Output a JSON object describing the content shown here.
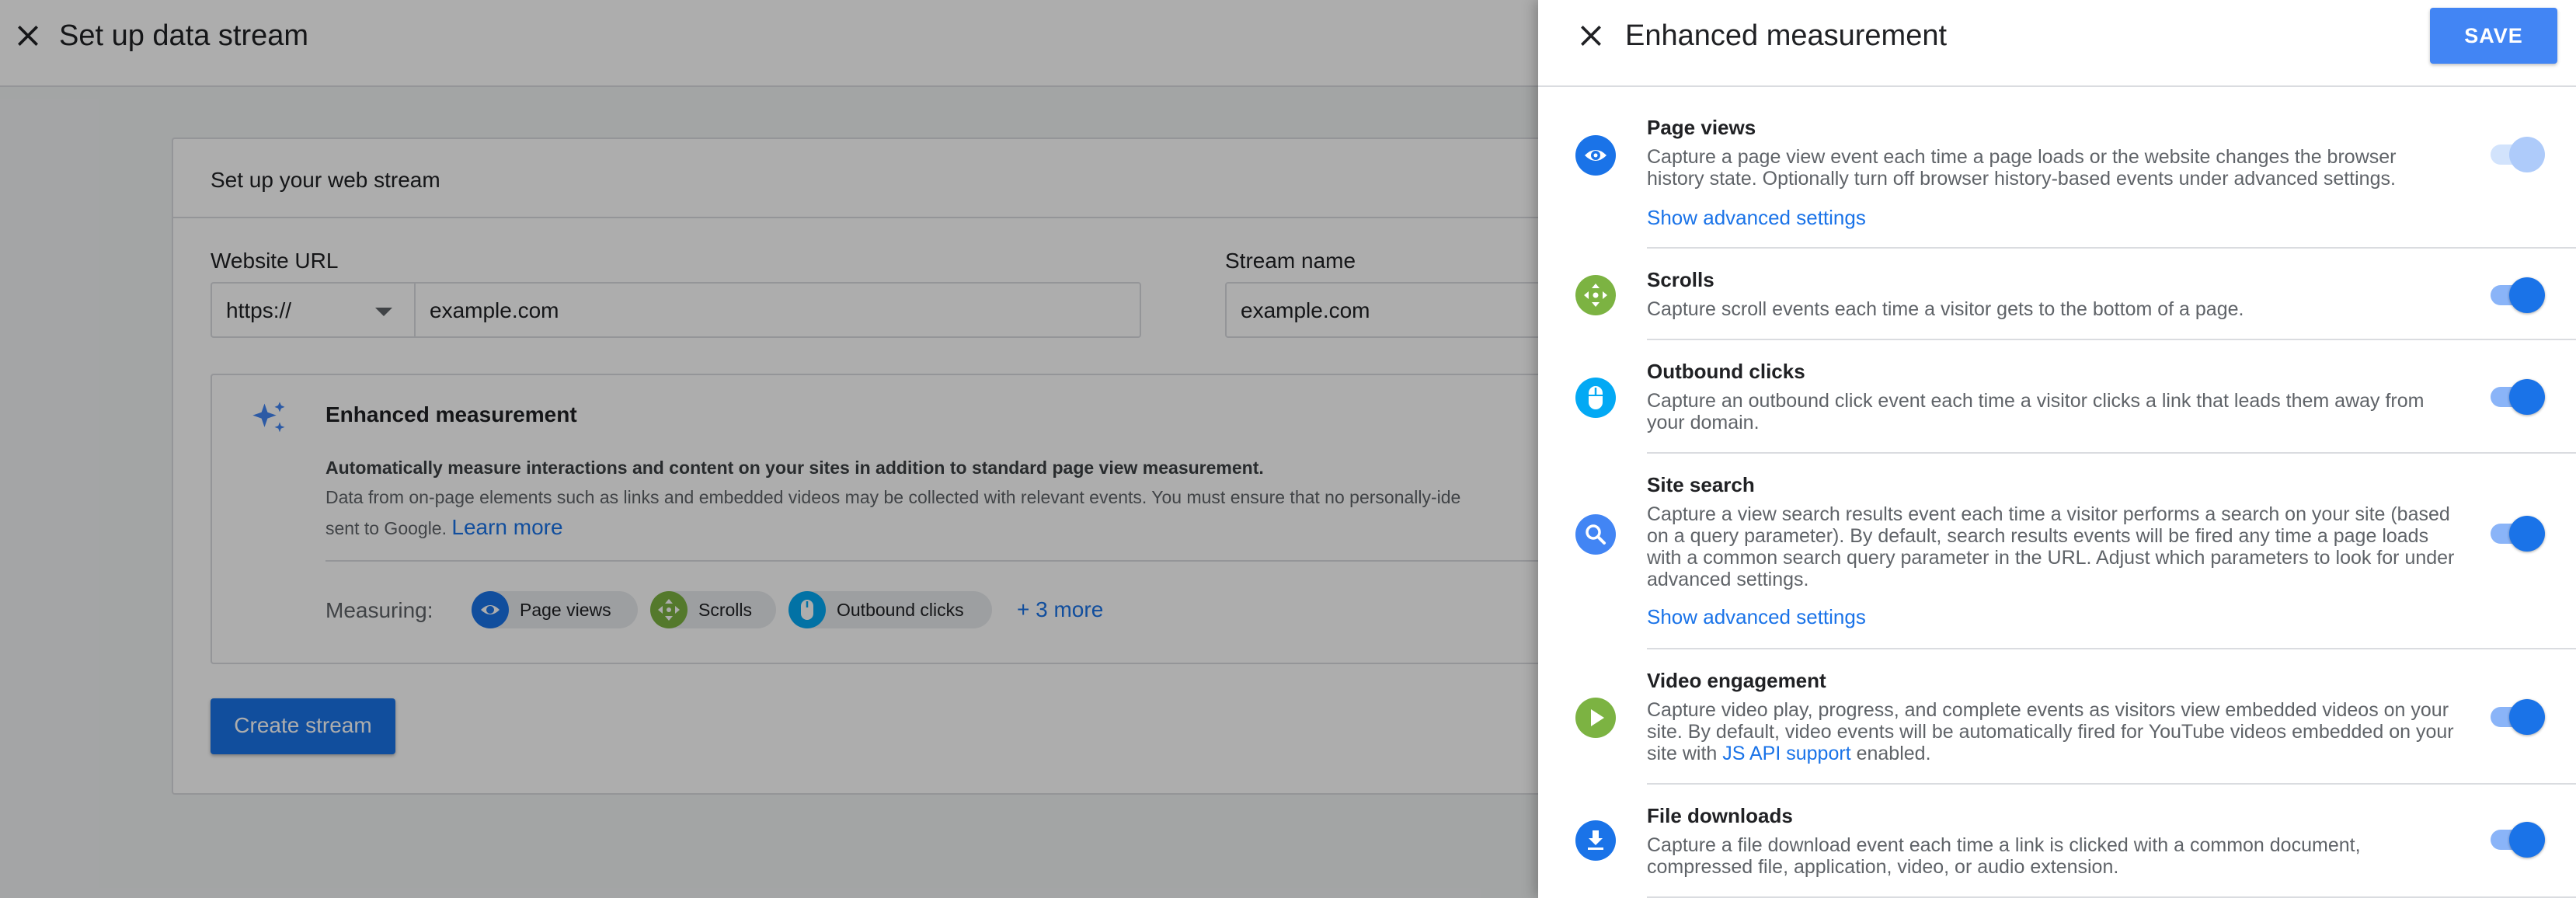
{
  "page": {
    "title": "Set up data stream",
    "card_title": "Set up your web stream",
    "website_url_label": "Website URL",
    "protocol_value": "https://",
    "url_value": "example.com",
    "stream_name_label": "Stream name",
    "stream_name_value": "example.com",
    "enhanced": {
      "title": "Enhanced measurement",
      "desc_bold": "Automatically measure interactions and content on your sites in addition to standard page view measurement.",
      "desc_line2": "Data from on-page elements such as links and embedded videos may be collected with relevant events. You must ensure that no personally-ide",
      "desc_line3_prefix": "sent to Google. ",
      "learn_more": "Learn more",
      "measuring_label": "Measuring:",
      "chips": [
        "Page views",
        "Scrolls",
        "Outbound clicks"
      ],
      "more": "+ 3 more"
    },
    "create_button": "Create stream"
  },
  "panel": {
    "title": "Enhanced measurement",
    "save": "SAVE",
    "items": [
      {
        "title": "Page views",
        "desc": "Capture a page view event each time a page loads or the website changes the browser history state. Optionally turn off browser history-based events under advanced settings.",
        "advanced": "Show advanced settings",
        "icon": "eye-icon",
        "enabled": true,
        "locked": true
      },
      {
        "title": "Scrolls",
        "desc": "Capture scroll events each time a visitor gets to the bottom of a page.",
        "icon": "scroll-arrows-icon",
        "enabled": true
      },
      {
        "title": "Outbound clicks",
        "desc": "Capture an outbound click event each time a visitor clicks a link that leads them away from your domain.",
        "icon": "mouse-icon",
        "enabled": true
      },
      {
        "title": "Site search",
        "desc": "Capture a view search results event each time a visitor performs a search on your site (based on a query parameter). By default, search results events will be fired any time a page loads with a common search query parameter in the URL. Adjust which parameters to look for under advanced settings.",
        "advanced": "Show advanced settings",
        "icon": "search-icon",
        "enabled": true
      },
      {
        "title": "Video engagement",
        "desc_prefix": "Capture video play, progress, and complete events as visitors view embedded videos on your site. By default, video events will be automatically fired for YouTube videos embedded on your site with ",
        "desc_link": "JS API support",
        "desc_suffix": " enabled.",
        "icon": "play-icon",
        "enabled": true
      },
      {
        "title": "File downloads",
        "desc": "Capture a file download event each time a link is clicked with a common document, compressed file, application, video, or audio extension.",
        "icon": "download-icon",
        "enabled": true
      }
    ]
  },
  "colors": {
    "accent": "#1a73e8",
    "save_button": "#4285f4",
    "icon_blue": "#1a73e8",
    "icon_green": "#7cb342",
    "icon_cyan": "#03a9f4"
  }
}
